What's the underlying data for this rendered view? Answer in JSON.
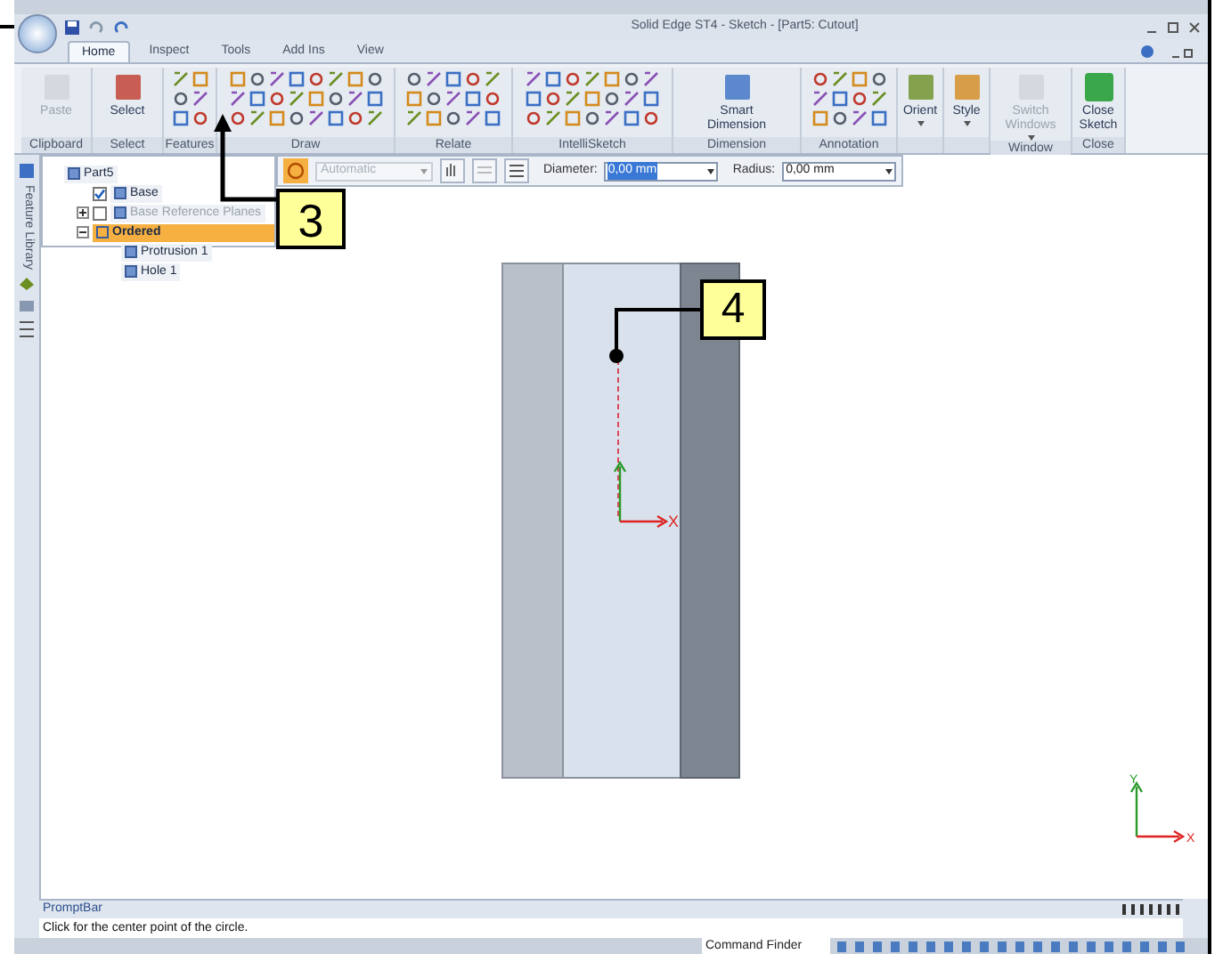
{
  "window": {
    "title": "Solid Edge ST4 - Sketch - [Part5: Cutout]"
  },
  "tabs": [
    {
      "label": "Home",
      "selected": true
    },
    {
      "label": "Inspect",
      "selected": false
    },
    {
      "label": "Tools",
      "selected": false
    },
    {
      "label": "Add Ins",
      "selected": false
    },
    {
      "label": "View",
      "selected": false
    }
  ],
  "ribbon_groups": [
    {
      "label": "Clipboard",
      "kind": "buttons",
      "buttons": [
        {
          "label": "Paste",
          "disabled": true,
          "dropdown": false
        }
      ]
    },
    {
      "label": "Select",
      "kind": "buttons",
      "buttons": [
        {
          "label": "Select",
          "disabled": false,
          "dropdown": false
        }
      ]
    },
    {
      "label": "Features",
      "kind": "tools"
    },
    {
      "label": "Draw",
      "kind": "tools"
    },
    {
      "label": "Relate",
      "kind": "tools"
    },
    {
      "label": "IntelliSketch",
      "kind": "tools"
    },
    {
      "label": "Dimension",
      "kind": "buttons",
      "buttons": [
        {
          "label": "Smart Dimension",
          "disabled": false,
          "dropdown": false
        }
      ]
    },
    {
      "label": "Annotation",
      "kind": "tools"
    },
    {
      "kind": "buttons",
      "buttons": [
        {
          "label": "Orient",
          "disabled": false,
          "dropdown": true
        }
      ]
    },
    {
      "kind": "buttons",
      "buttons": [
        {
          "label": "Style",
          "disabled": false,
          "dropdown": true
        }
      ]
    },
    {
      "label": "Window",
      "kind": "buttons",
      "buttons": [
        {
          "label": "Switch Windows",
          "disabled": true,
          "dropdown": true
        }
      ]
    },
    {
      "label": "Close",
      "kind": "buttons",
      "buttons": [
        {
          "label": "Close Sketch",
          "disabled": false,
          "dropdown": false
        }
      ]
    }
  ],
  "side_tab": {
    "label": "Feature Library"
  },
  "tree": [
    {
      "label": "Part5",
      "selected": false,
      "children": [
        {
          "label": "Base",
          "selected": false,
          "checked": true
        },
        {
          "label": "Base Reference Planes",
          "selected": false,
          "checked": false,
          "expanded": false
        },
        {
          "label": "Ordered",
          "selected": true,
          "expanded": true,
          "children": [
            {
              "label": "Protrusion 1",
              "selected": false
            },
            {
              "label": "Hole 1",
              "selected": false
            }
          ]
        }
      ]
    }
  ],
  "options_bar": {
    "mode": {
      "value": "Automatic",
      "disabled": true
    },
    "diameter": {
      "label": "Diameter:",
      "value": "0,00 mm",
      "highlighted": true
    },
    "radius": {
      "label": "Radius:",
      "value": "0,00 mm",
      "highlighted": false
    }
  },
  "canvas": {
    "sketch_axis_label": "X",
    "triad": {
      "x": "X",
      "y": "Y"
    }
  },
  "callouts": [
    {
      "label": "3"
    },
    {
      "label": "4"
    }
  ],
  "prompt_bar": {
    "title": "PromptBar",
    "message": "Click for the center point of the circle."
  },
  "status_bar": {
    "command_finder": "Command Finder"
  }
}
